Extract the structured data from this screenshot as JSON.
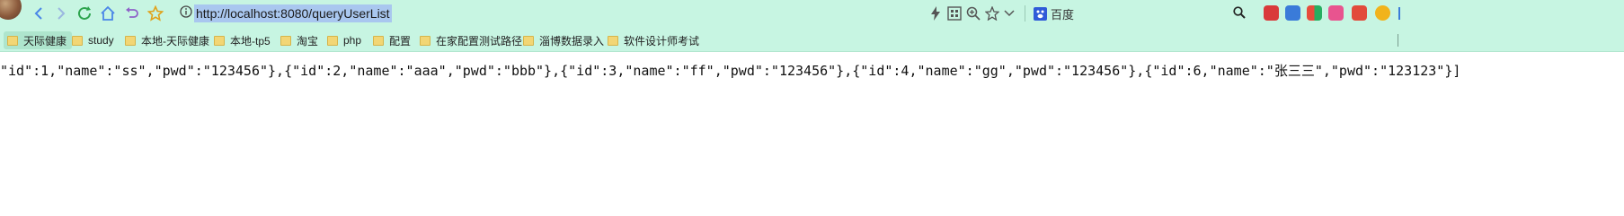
{
  "address_bar": {
    "url": "http://localhost:8080/queryUserList"
  },
  "search_engine": {
    "label": "百度"
  },
  "bookmarks": [
    {
      "label": "天际健康"
    },
    {
      "label": "study"
    },
    {
      "label": "本地-天际健康"
    },
    {
      "label": "本地-tp5"
    },
    {
      "label": "淘宝"
    },
    {
      "label": "php"
    },
    {
      "label": "配置"
    },
    {
      "label": "在家配置测试路径"
    },
    {
      "label": "淄博数据录入"
    },
    {
      "label": "软件设计师考试"
    }
  ],
  "page": {
    "json_text": "\"id\":1,\"name\":\"ss\",\"pwd\":\"123456\"},{\"id\":2,\"name\":\"aaa\",\"pwd\":\"bbb\"},{\"id\":3,\"name\":\"ff\",\"pwd\":\"123456\"},{\"id\":4,\"name\":\"gg\",\"pwd\":\"123456\"},{\"id\":6,\"name\":\"张三三\",\"pwd\":\"123123\"}]"
  },
  "colors": {
    "toolbar_bg": "#c7f5e2",
    "url_highlight": "#a9c7ef",
    "nav_blue": "#4a86e8",
    "reload_green": "#2da44e"
  }
}
